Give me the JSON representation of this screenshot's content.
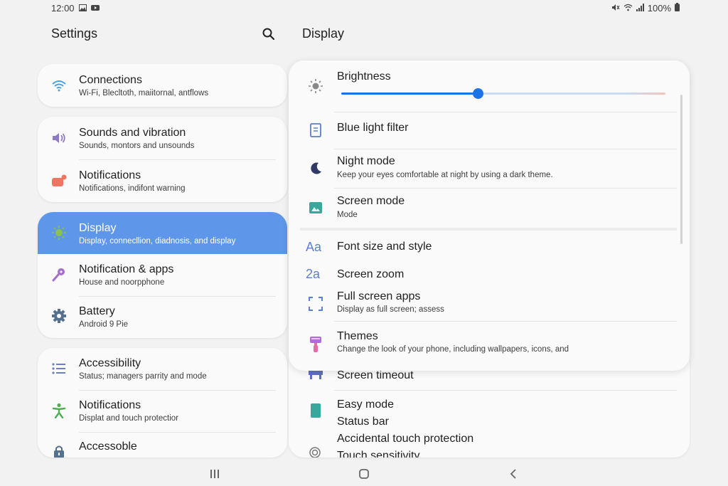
{
  "status_bar": {
    "time": "12:00",
    "battery": "100%"
  },
  "settings_pane": {
    "title": "Settings",
    "groups": [
      {
        "items": [
          {
            "title": "Connections",
            "subtitle": "Wi-Fi, Blecltoth, maiitornal, antflows",
            "icon": "wifi-icon"
          }
        ]
      },
      {
        "items": [
          {
            "title": "Sounds and vibration",
            "subtitle": "Sounds, montors and unsounds",
            "icon": "speaker-icon"
          },
          {
            "title": "Notifications",
            "subtitle": "Notifications, indifont warning",
            "icon": "notification-icon"
          }
        ]
      },
      {
        "items": [
          {
            "title": "Display",
            "subtitle": "Display, connecllion, diadnosis, and display",
            "icon": "sun-icon",
            "selected": true
          },
          {
            "title": "Notification & apps",
            "subtitle": "House and noorpphone",
            "icon": "key-icon"
          },
          {
            "title": "Battery",
            "subtitle": "Android 9 Pie",
            "icon": "gear-icon"
          }
        ]
      },
      {
        "items": [
          {
            "title": "Accessibility",
            "subtitle": "Status; managers parrity and mode",
            "icon": "list-icon"
          },
          {
            "title": "Notifications",
            "subtitle": "Displat and touch protectior",
            "icon": "person-icon"
          },
          {
            "title": "Accessoble",
            "subtitle": "",
            "icon": "lock-icon"
          }
        ]
      }
    ]
  },
  "display_pane": {
    "title": "Display",
    "brightness": {
      "label": "Brightness",
      "level": 0.42
    },
    "items": [
      {
        "title": "Blue light filter",
        "subtitle": "",
        "icon": "document-icon"
      },
      {
        "title": "Night mode",
        "subtitle": "Keep your eyes comfortable at night by using a dark theme.",
        "icon": "moon-icon"
      },
      {
        "title": "Screen mode",
        "subtitle": "Mode",
        "icon": "image-icon"
      },
      {
        "title": "Font size and style",
        "subtitle": "",
        "icon": "font-icon",
        "glyph": "Aa"
      },
      {
        "title": "Screen zoom",
        "subtitle": "",
        "icon": "zoom-icon",
        "glyph": "2a"
      },
      {
        "title": "Full screen apps",
        "subtitle": "Display as full screen; assess",
        "icon": "fullscreen-icon"
      },
      {
        "title": "Themes",
        "subtitle": "Change the look of your phone, including wallpapers, icons, and",
        "icon": "brush-icon"
      }
    ],
    "more_items": [
      {
        "title": "Screen timeout",
        "icon": "timeout-icon"
      },
      {
        "title": "Easy mode",
        "icon": "easy-mode-icon"
      },
      {
        "title": "Status bar"
      },
      {
        "title": "Accidental touch protection"
      },
      {
        "title": "Touch sensitivity",
        "icon": "touch-icon"
      }
    ]
  },
  "colors": {
    "accent": "#5e97ea",
    "slider": "#1a73e8",
    "background": "#f2f2f2",
    "card": "#fafafa"
  }
}
